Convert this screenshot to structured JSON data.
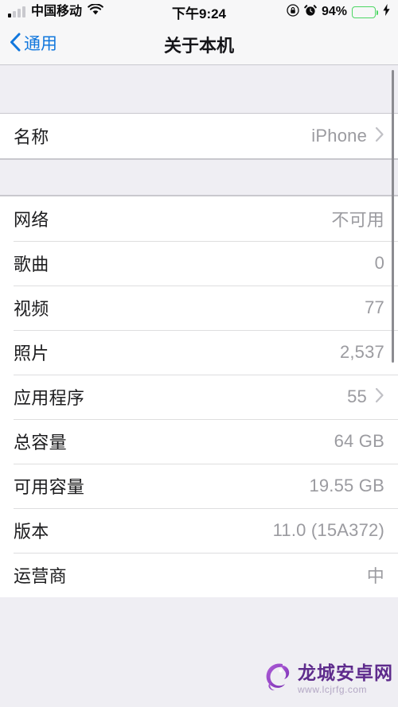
{
  "status_bar": {
    "carrier": "中国移动",
    "wifi_icon": "wifi-icon",
    "signal_icon": "signal-bars-icon",
    "time": "下午9:24",
    "rotation_lock_icon": "rotation-lock-icon",
    "alarm_icon": "alarm-clock-icon",
    "battery_percent": "94%",
    "battery_level": 94,
    "battery_color": "#4cd663",
    "charging_icon": "lightning-bolt-icon"
  },
  "nav": {
    "back_label": "通用",
    "back_icon": "chevron-left-icon",
    "title": "关于本机",
    "accent_color": "#1177dd"
  },
  "groups": [
    {
      "rows": [
        {
          "label": "名称",
          "value": "iPhone",
          "chevron": true
        }
      ]
    },
    {
      "rows": [
        {
          "label": "网络",
          "value": "不可用",
          "chevron": false
        },
        {
          "label": "歌曲",
          "value": "0",
          "chevron": false
        },
        {
          "label": "视频",
          "value": "77",
          "chevron": false
        },
        {
          "label": "照片",
          "value": "2,537",
          "chevron": false
        },
        {
          "label": "应用程序",
          "value": "55",
          "chevron": true
        },
        {
          "label": "总容量",
          "value": "64 GB",
          "chevron": false
        },
        {
          "label": "可用容量",
          "value": "19.55 GB",
          "chevron": false
        },
        {
          "label": "版本",
          "value": "11.0 (15A372)",
          "chevron": false
        },
        {
          "label": "运营商",
          "value": "中",
          "chevron": false
        }
      ]
    }
  ],
  "watermark": {
    "logo_icon": "dragon-logo-icon",
    "title": "龙城安卓网",
    "url": "www.lcjrfg.com",
    "color": "#5e2b8c"
  }
}
